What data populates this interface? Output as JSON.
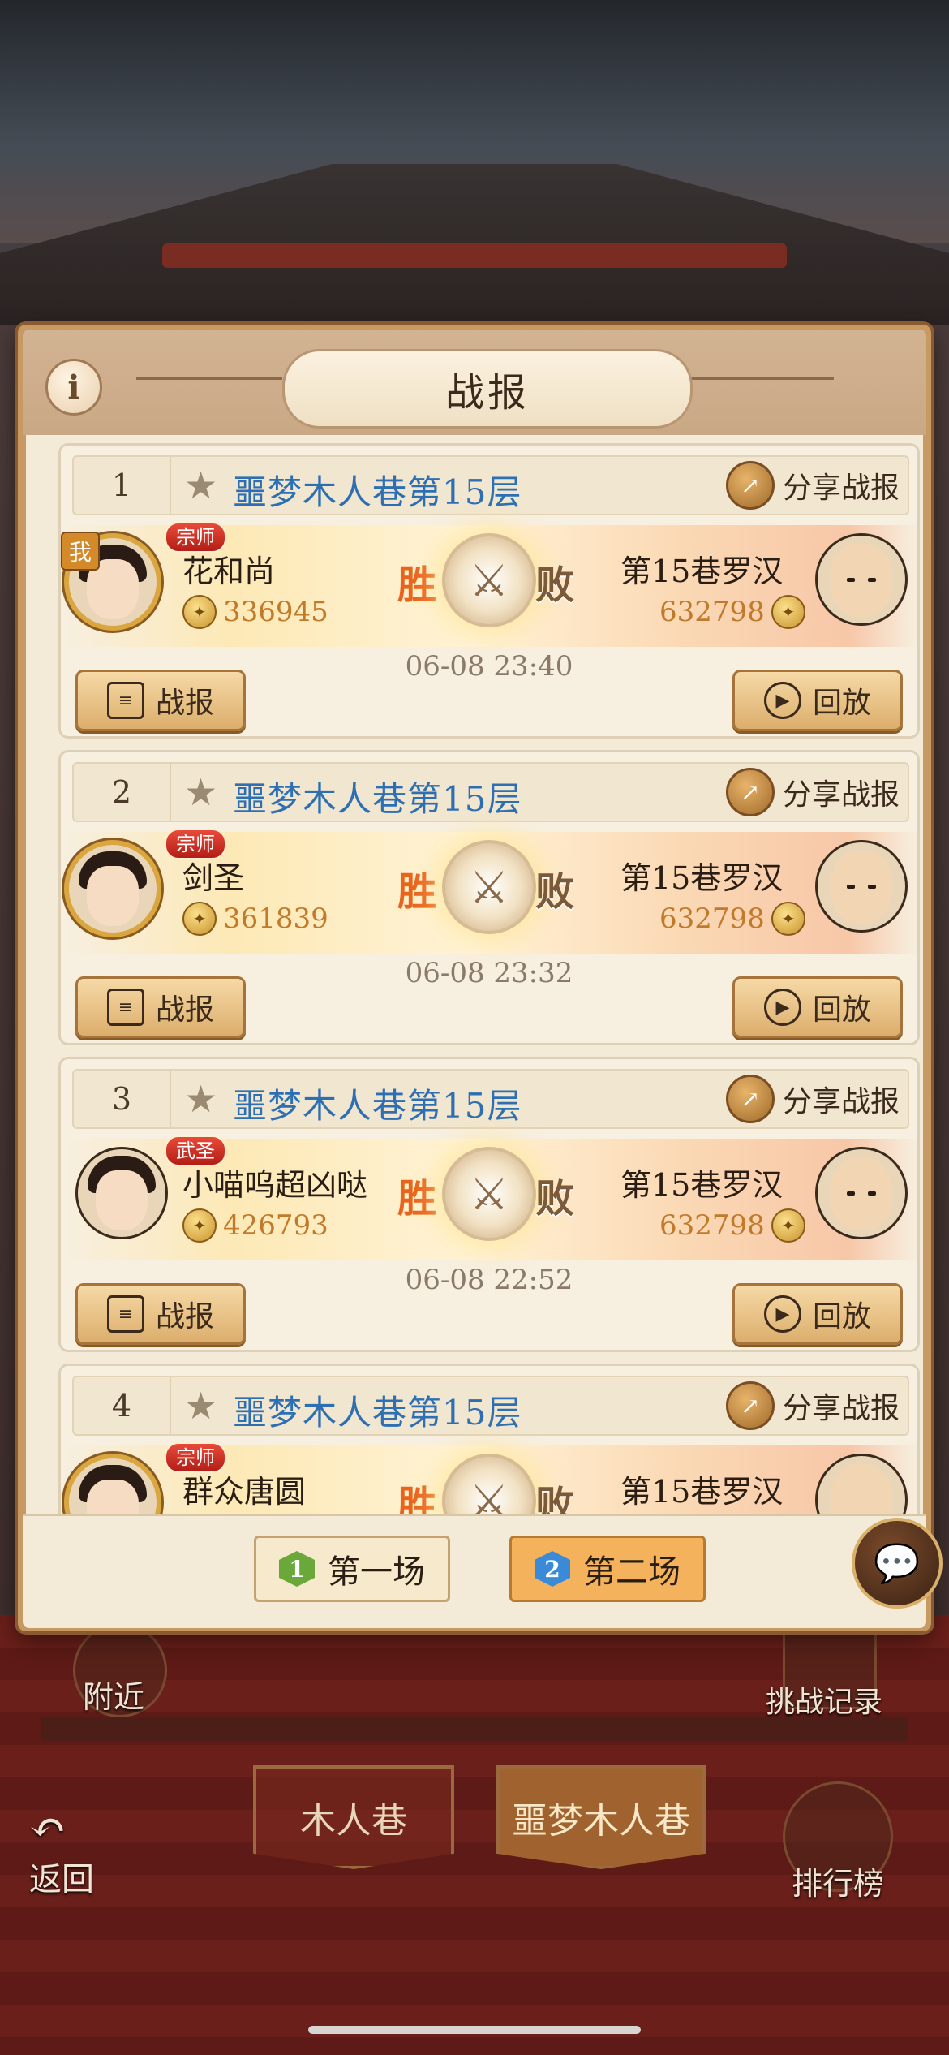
{
  "dialog": {
    "title": "战报",
    "info_label": "i"
  },
  "reports": [
    {
      "rank": "1",
      "level": "噩梦木人巷第15层",
      "share_label": "分享战报",
      "player": {
        "name": "花和尚",
        "title_badge": "宗师",
        "power": "336945",
        "me_tag": "我"
      },
      "opponent": {
        "name": "第15巷罗汉",
        "power": "632798"
      },
      "win_label": "胜",
      "lose_label": "败",
      "time": "06-08 23:40",
      "report_button": "战报",
      "replay_button": "回放"
    },
    {
      "rank": "2",
      "level": "噩梦木人巷第15层",
      "share_label": "分享战报",
      "player": {
        "name": "剑圣",
        "title_badge": "宗师",
        "power": "361839"
      },
      "opponent": {
        "name": "第15巷罗汉",
        "power": "632798"
      },
      "win_label": "胜",
      "lose_label": "败",
      "time": "06-08 23:32",
      "report_button": "战报",
      "replay_button": "回放"
    },
    {
      "rank": "3",
      "level": "噩梦木人巷第15层",
      "share_label": "分享战报",
      "player": {
        "name": "小喵呜超凶哒",
        "title_badge": "武圣",
        "power": "426793"
      },
      "opponent": {
        "name": "第15巷罗汉",
        "power": "632798"
      },
      "win_label": "胜",
      "lose_label": "败",
      "time": "06-08 22:52",
      "report_button": "战报",
      "replay_button": "回放"
    },
    {
      "rank": "4",
      "level": "噩梦木人巷第15层",
      "share_label": "分享战报",
      "player": {
        "name": "群众唐圆",
        "title_badge": "宗师"
      },
      "opponent": {
        "name": "第15巷罗汉"
      },
      "win_label": "胜",
      "lose_label": "败"
    }
  ],
  "footer": {
    "round1": {
      "num": "1",
      "label": "第一场"
    },
    "round2": {
      "num": "2",
      "label": "第二场"
    }
  },
  "background": {
    "nearby": "附近",
    "challenge_log": "挑战记录",
    "tab_wooden": "木人巷",
    "tab_nightmare": "噩梦木人巷",
    "back": "返回",
    "leaderboard": "排行榜"
  },
  "colors": {
    "level_title": "#2d6fb2",
    "win": "#e8641e",
    "power": "#c07a2a",
    "badge_red": "#d8342a",
    "round1_icon": "#6aa83a",
    "round2_icon": "#3a8ad8",
    "round2_active": "#f4b25c"
  },
  "icons": [
    "info-icon",
    "star-icon",
    "share-icon",
    "coin-icon",
    "crossed-swords-icon",
    "list-icon",
    "play-icon",
    "chat-icon"
  ]
}
